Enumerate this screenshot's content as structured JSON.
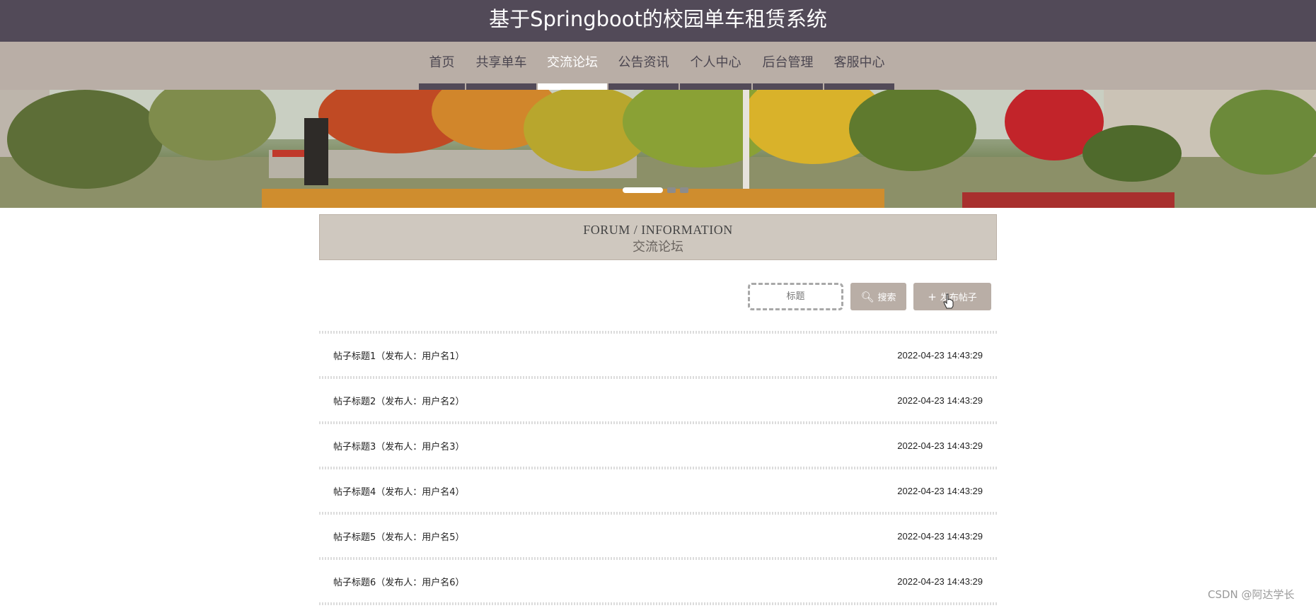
{
  "header": {
    "title": "基于Springboot的校园单车租赁系统"
  },
  "nav": {
    "items": [
      {
        "label": "首页"
      },
      {
        "label": "共享单车"
      },
      {
        "label": "交流论坛",
        "active": true
      },
      {
        "label": "公告资讯"
      },
      {
        "label": "个人中心"
      },
      {
        "label": "后台管理"
      },
      {
        "label": "客服中心"
      }
    ]
  },
  "carousel": {
    "slide_count": 3,
    "active_index": 0
  },
  "section": {
    "title_en": "FORUM / INFORMATION",
    "title_cn": "交流论坛"
  },
  "search": {
    "placeholder": "标题",
    "search_label": "搜索",
    "post_label": "发布帖子"
  },
  "posts": [
    {
      "title": "帖子标题1（发布人：用户名1）",
      "time": "2022-04-23 14:43:29"
    },
    {
      "title": "帖子标题2（发布人：用户名2）",
      "time": "2022-04-23 14:43:29"
    },
    {
      "title": "帖子标题3（发布人：用户名3）",
      "time": "2022-04-23 14:43:29"
    },
    {
      "title": "帖子标题4（发布人：用户名4）",
      "time": "2022-04-23 14:43:29"
    },
    {
      "title": "帖子标题5（发布人：用户名5）",
      "time": "2022-04-23 14:43:29"
    },
    {
      "title": "帖子标题6（发布人：用户名6）",
      "time": "2022-04-23 14:43:29"
    }
  ],
  "watermark": "CSDN @阿达学长",
  "colors": {
    "header_bg": "#524a58",
    "nav_bg": "#b9aea6",
    "accent": "#b9aea6",
    "section_bg": "#cfc8bf"
  }
}
